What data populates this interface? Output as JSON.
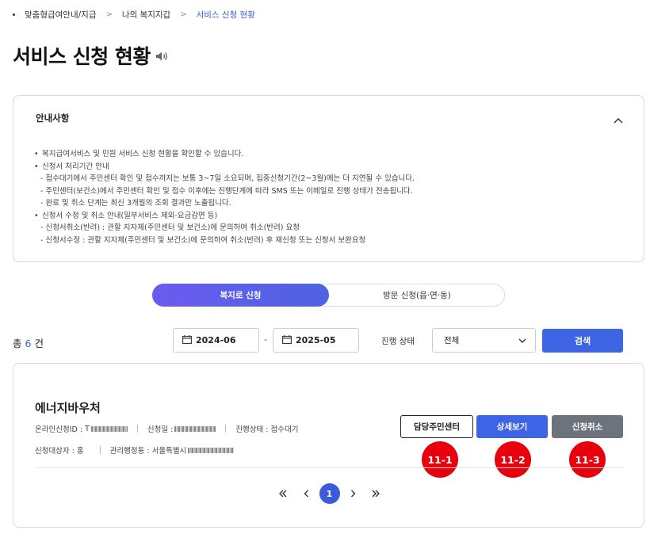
{
  "breadcrumb": {
    "items": [
      "맞춤형급여안내/지급",
      "나의 복지지갑",
      "서비스 신청 현황"
    ]
  },
  "page": {
    "title": "서비스 신청 현황"
  },
  "notice": {
    "title": "안내사항",
    "lines": [
      "복지급여서비스 및 민원 서비스 신청 현황을 확인할 수 있습니다.",
      "신청서 처리기간 안내",
      "- 접수대기에서 주민센터 확인 및 접수까지는 보통 3~7일 소요되며, 집중신청기간(2~3월)에는 더 지연될 수 있습니다.",
      "- 주민센터(보건소)에서 주민센터 확인 및 접수 이후에는 진행단계에 따라 SMS 또는 이메일로 진행 상태가 전송됩니다.",
      "- 완료 및 취소 단계는 최신 3개월의 조회 결과만 노출됩니다.",
      "신청서 수정 및 취소 안내(일부서비스 제외-요금감면 등)",
      "- 신청서취소(반려) : 관할 지자체(주민센터 및 보건소)에 문의하여 취소(반려) 요청",
      "- 신청서수정 : 관할 지자체(주민센터 및 보건소)에 문의하여 취소(반려) 후 재신청 또는 신청서 보완요청"
    ]
  },
  "tabs": {
    "online": "복지로 신청",
    "visit": "방문 신청(읍·면·동)"
  },
  "filter": {
    "total_prefix": "총",
    "total_count": "6",
    "total_suffix": "건",
    "date_from": "2024-06",
    "date_sep": "-",
    "date_to": "2025-05",
    "status_label": "진행 상태",
    "status_value": "전체",
    "search_label": "검색"
  },
  "result": {
    "service_name": "에너지바우처",
    "online_id_label": "온라인신청ID :",
    "online_id_value": "T",
    "apply_date_label": "신청일 :",
    "progress_label": "진행상태 :",
    "progress_value": "접수대기",
    "target_label": "신청대상자 :",
    "target_value": "홍",
    "office_label": "관리행정동 :",
    "office_value": "서울특별시",
    "btn_center": "담당주민센터",
    "btn_detail": "상세보기",
    "btn_cancel": "신청취소",
    "callouts": [
      "11-1",
      "11-2",
      "11-3"
    ]
  },
  "pagination": {
    "current": "1"
  },
  "colors": {
    "accent": "#3d64e4",
    "toggle_gradient_start": "#6b5bf0",
    "cancel_btn": "#6c737d",
    "callout": "#e8000d"
  }
}
